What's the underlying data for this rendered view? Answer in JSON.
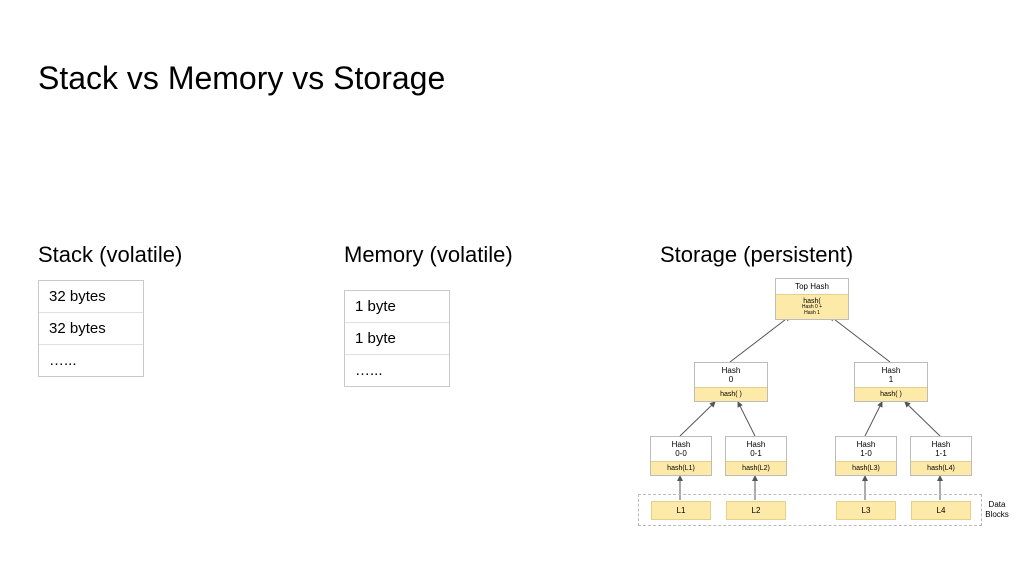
{
  "title": "Stack vs Memory vs Storage",
  "columns": {
    "stack": {
      "heading": "Stack (volatile)",
      "rows": [
        "32 bytes",
        "32 bytes",
        "…..."
      ]
    },
    "memory": {
      "heading": "Memory (volatile)",
      "rows": [
        "1 byte",
        "1 byte",
        "…..."
      ]
    },
    "storage": {
      "heading": "Storage (persistent)"
    }
  },
  "tree": {
    "top": {
      "title": "Top Hash",
      "hash_label": "hash(",
      "hash_lines": [
        "Hash 0 +",
        "Hash 1"
      ]
    },
    "level1": [
      {
        "title": "Hash\n0",
        "hash": "hash(        )"
      },
      {
        "title": "Hash\n1",
        "hash": "hash(        )"
      }
    ],
    "level2": [
      {
        "title": "Hash\n0-0",
        "hash": "hash(L1)"
      },
      {
        "title": "Hash\n0-1",
        "hash": "hash(L2)"
      },
      {
        "title": "Hash\n1-0",
        "hash": "hash(L3)"
      },
      {
        "title": "Hash\n1-1",
        "hash": "hash(L4)"
      }
    ],
    "leaves": [
      "L1",
      "L2",
      "L3",
      "L4"
    ],
    "data_blocks_label": "Data\nBlocks"
  }
}
